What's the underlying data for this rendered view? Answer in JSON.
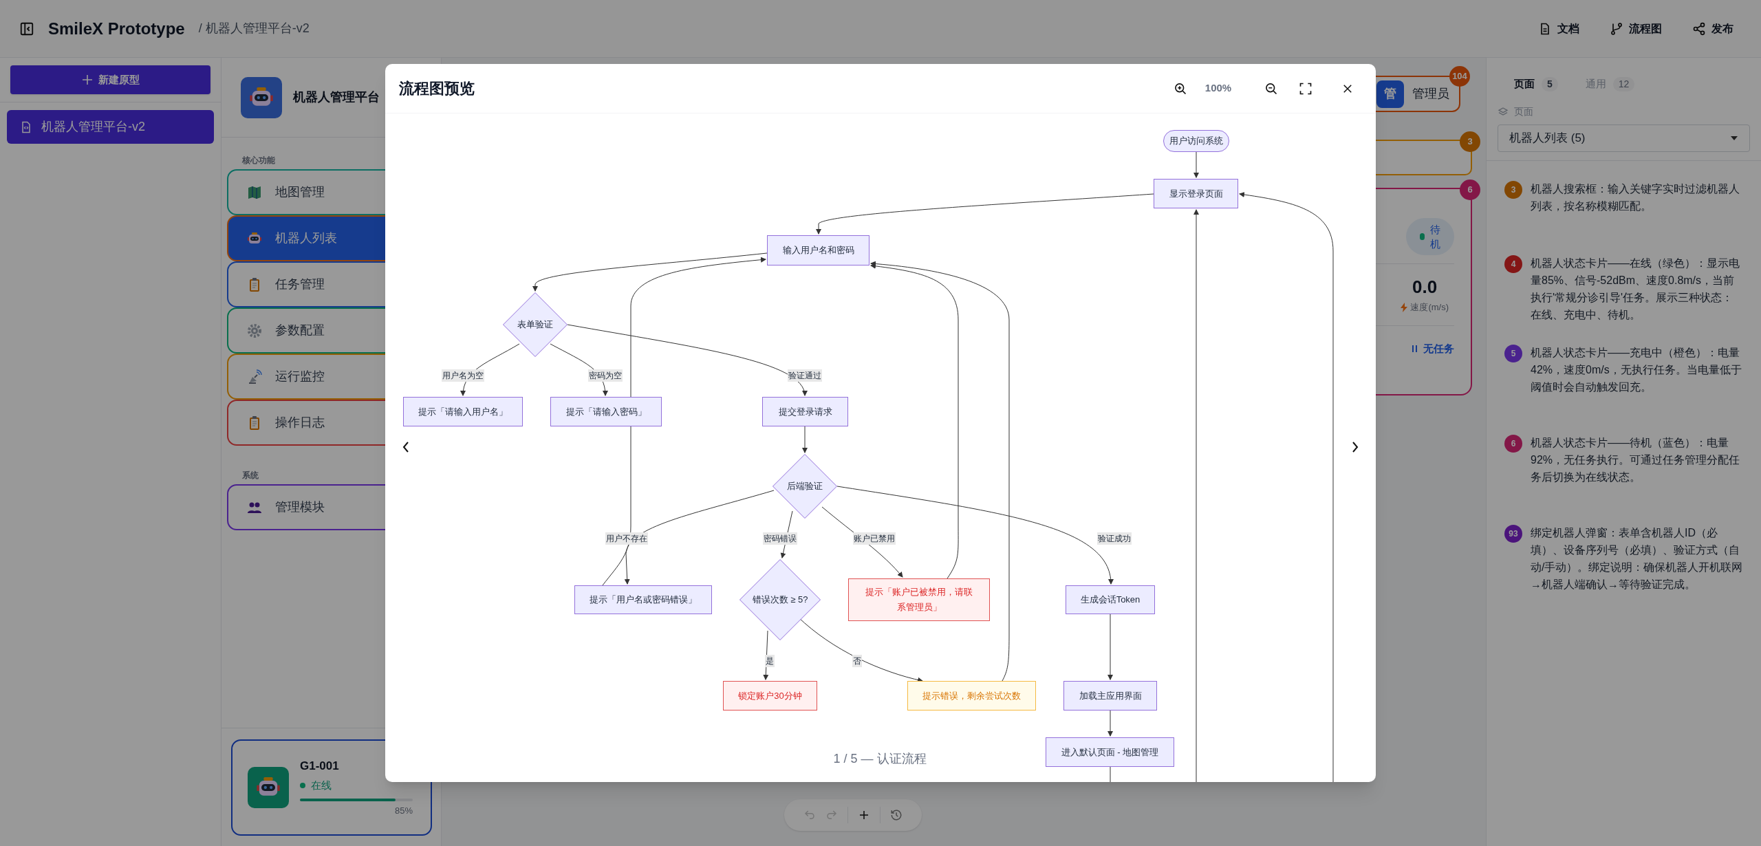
{
  "header": {
    "title": "SmileX Prototype",
    "breadcrumb": "/ 机器人管理平台-v2",
    "actions": [
      {
        "label": "文档"
      },
      {
        "label": "流程图"
      },
      {
        "label": "发布"
      }
    ]
  },
  "sidebar": {
    "new_button": "新建原型",
    "projects": [
      {
        "label": "机器人管理平台-v2",
        "selected": true
      }
    ]
  },
  "prototype": {
    "app_title": "机器人管理平台",
    "nav_sections": [
      {
        "title": "核心功能",
        "items": [
          {
            "label": "地图管理",
            "selected": false
          },
          {
            "label": "机器人列表",
            "selected": true
          },
          {
            "label": "任务管理",
            "selected": false
          },
          {
            "label": "参数配置",
            "selected": false
          },
          {
            "label": "运行监控",
            "selected": false
          },
          {
            "label": "操作日志",
            "selected": false
          }
        ]
      },
      {
        "title": "系统",
        "items": [
          {
            "label": "管理模块",
            "selected": false
          }
        ]
      }
    ],
    "robot_card": {
      "name": "G1-001",
      "status": "在线",
      "level": 0.85,
      "reading": "85%"
    },
    "user_badge": {
      "avatar": "管",
      "name": "管理员",
      "marker": "104"
    },
    "search_marker": "3",
    "status_card": {
      "marker": "6",
      "status": "待机",
      "speed": "0.0",
      "speed_label": "速度(m/s)",
      "task": "无任务"
    }
  },
  "modal": {
    "title": "流程图预览",
    "zoom": "100%",
    "caption": "1 / 5 — 认证流程",
    "flowchart": {
      "nodes": [
        {
          "kind": "start",
          "text": "用户访问系统"
        },
        {
          "kind": "process",
          "text": "显示登录页面"
        },
        {
          "kind": "process",
          "text": "输入用户名和密码"
        },
        {
          "kind": "decision",
          "text": "表单验证"
        },
        {
          "kind": "process",
          "text": "提示「请输入用户名」"
        },
        {
          "kind": "process",
          "text": "提示「请输入密码」"
        },
        {
          "kind": "process",
          "text": "提交登录请求"
        },
        {
          "kind": "decision",
          "text": "后端验证"
        },
        {
          "kind": "process",
          "text": "提示「用户名或密码错误」"
        },
        {
          "kind": "decision",
          "text": "错误次数 ≥ 5?"
        },
        {
          "kind": "error",
          "text": "提示「账户已被禁用，请联系管理员」"
        },
        {
          "kind": "process",
          "text": "生成会话Token"
        },
        {
          "kind": "error",
          "text": "锁定账户30分钟"
        },
        {
          "kind": "warning",
          "text": "提示错误，剩余尝试次数"
        },
        {
          "kind": "process",
          "text": "加载主应用界面"
        },
        {
          "kind": "process",
          "text": "进入默认页面 - 地图管理"
        }
      ],
      "edge_labels": [
        "用户名为空",
        "密码为空",
        "验证通过",
        "用户不存在",
        "密码错误",
        "账户已禁用",
        "验证成功",
        "是",
        "否"
      ]
    }
  },
  "right_panel": {
    "tabs": [
      {
        "label": "页面",
        "count": "5",
        "selected": true
      },
      {
        "label": "通用",
        "count": "12",
        "selected": false
      }
    ],
    "section_label": "页面",
    "page_select": "机器人列表 (5)",
    "annotations": [
      {
        "number": "3",
        "text": "机器人搜索框：输入关键字实时过滤机器人列表，按名称模糊匹配。"
      },
      {
        "number": "4",
        "text": "机器人状态卡片——在线（绿色）：显示电量85%、信号-52dBm、速度0.8m/s，当前执行'常规分诊引导'任务。展示三种状态：在线、充电中、待机。"
      },
      {
        "number": "5",
        "text": "机器人状态卡片——充电中（橙色）：电量42%，速度0m/s，无执行任务。当电量低于阈值时会自动触发回充。"
      },
      {
        "number": "6",
        "text": "机器人状态卡片——待机（蓝色）：电量92%，无任务执行。可通过任务管理分配任务后切换为在线状态。"
      },
      {
        "number": "93",
        "text": "绑定机器人弹窗：表单含机器人ID（必填）、设备序列号（必填）、验证方式（自动/手动）。绑定说明：确保机器人开机联网→机器人端确认→等待验证完成。"
      }
    ]
  }
}
